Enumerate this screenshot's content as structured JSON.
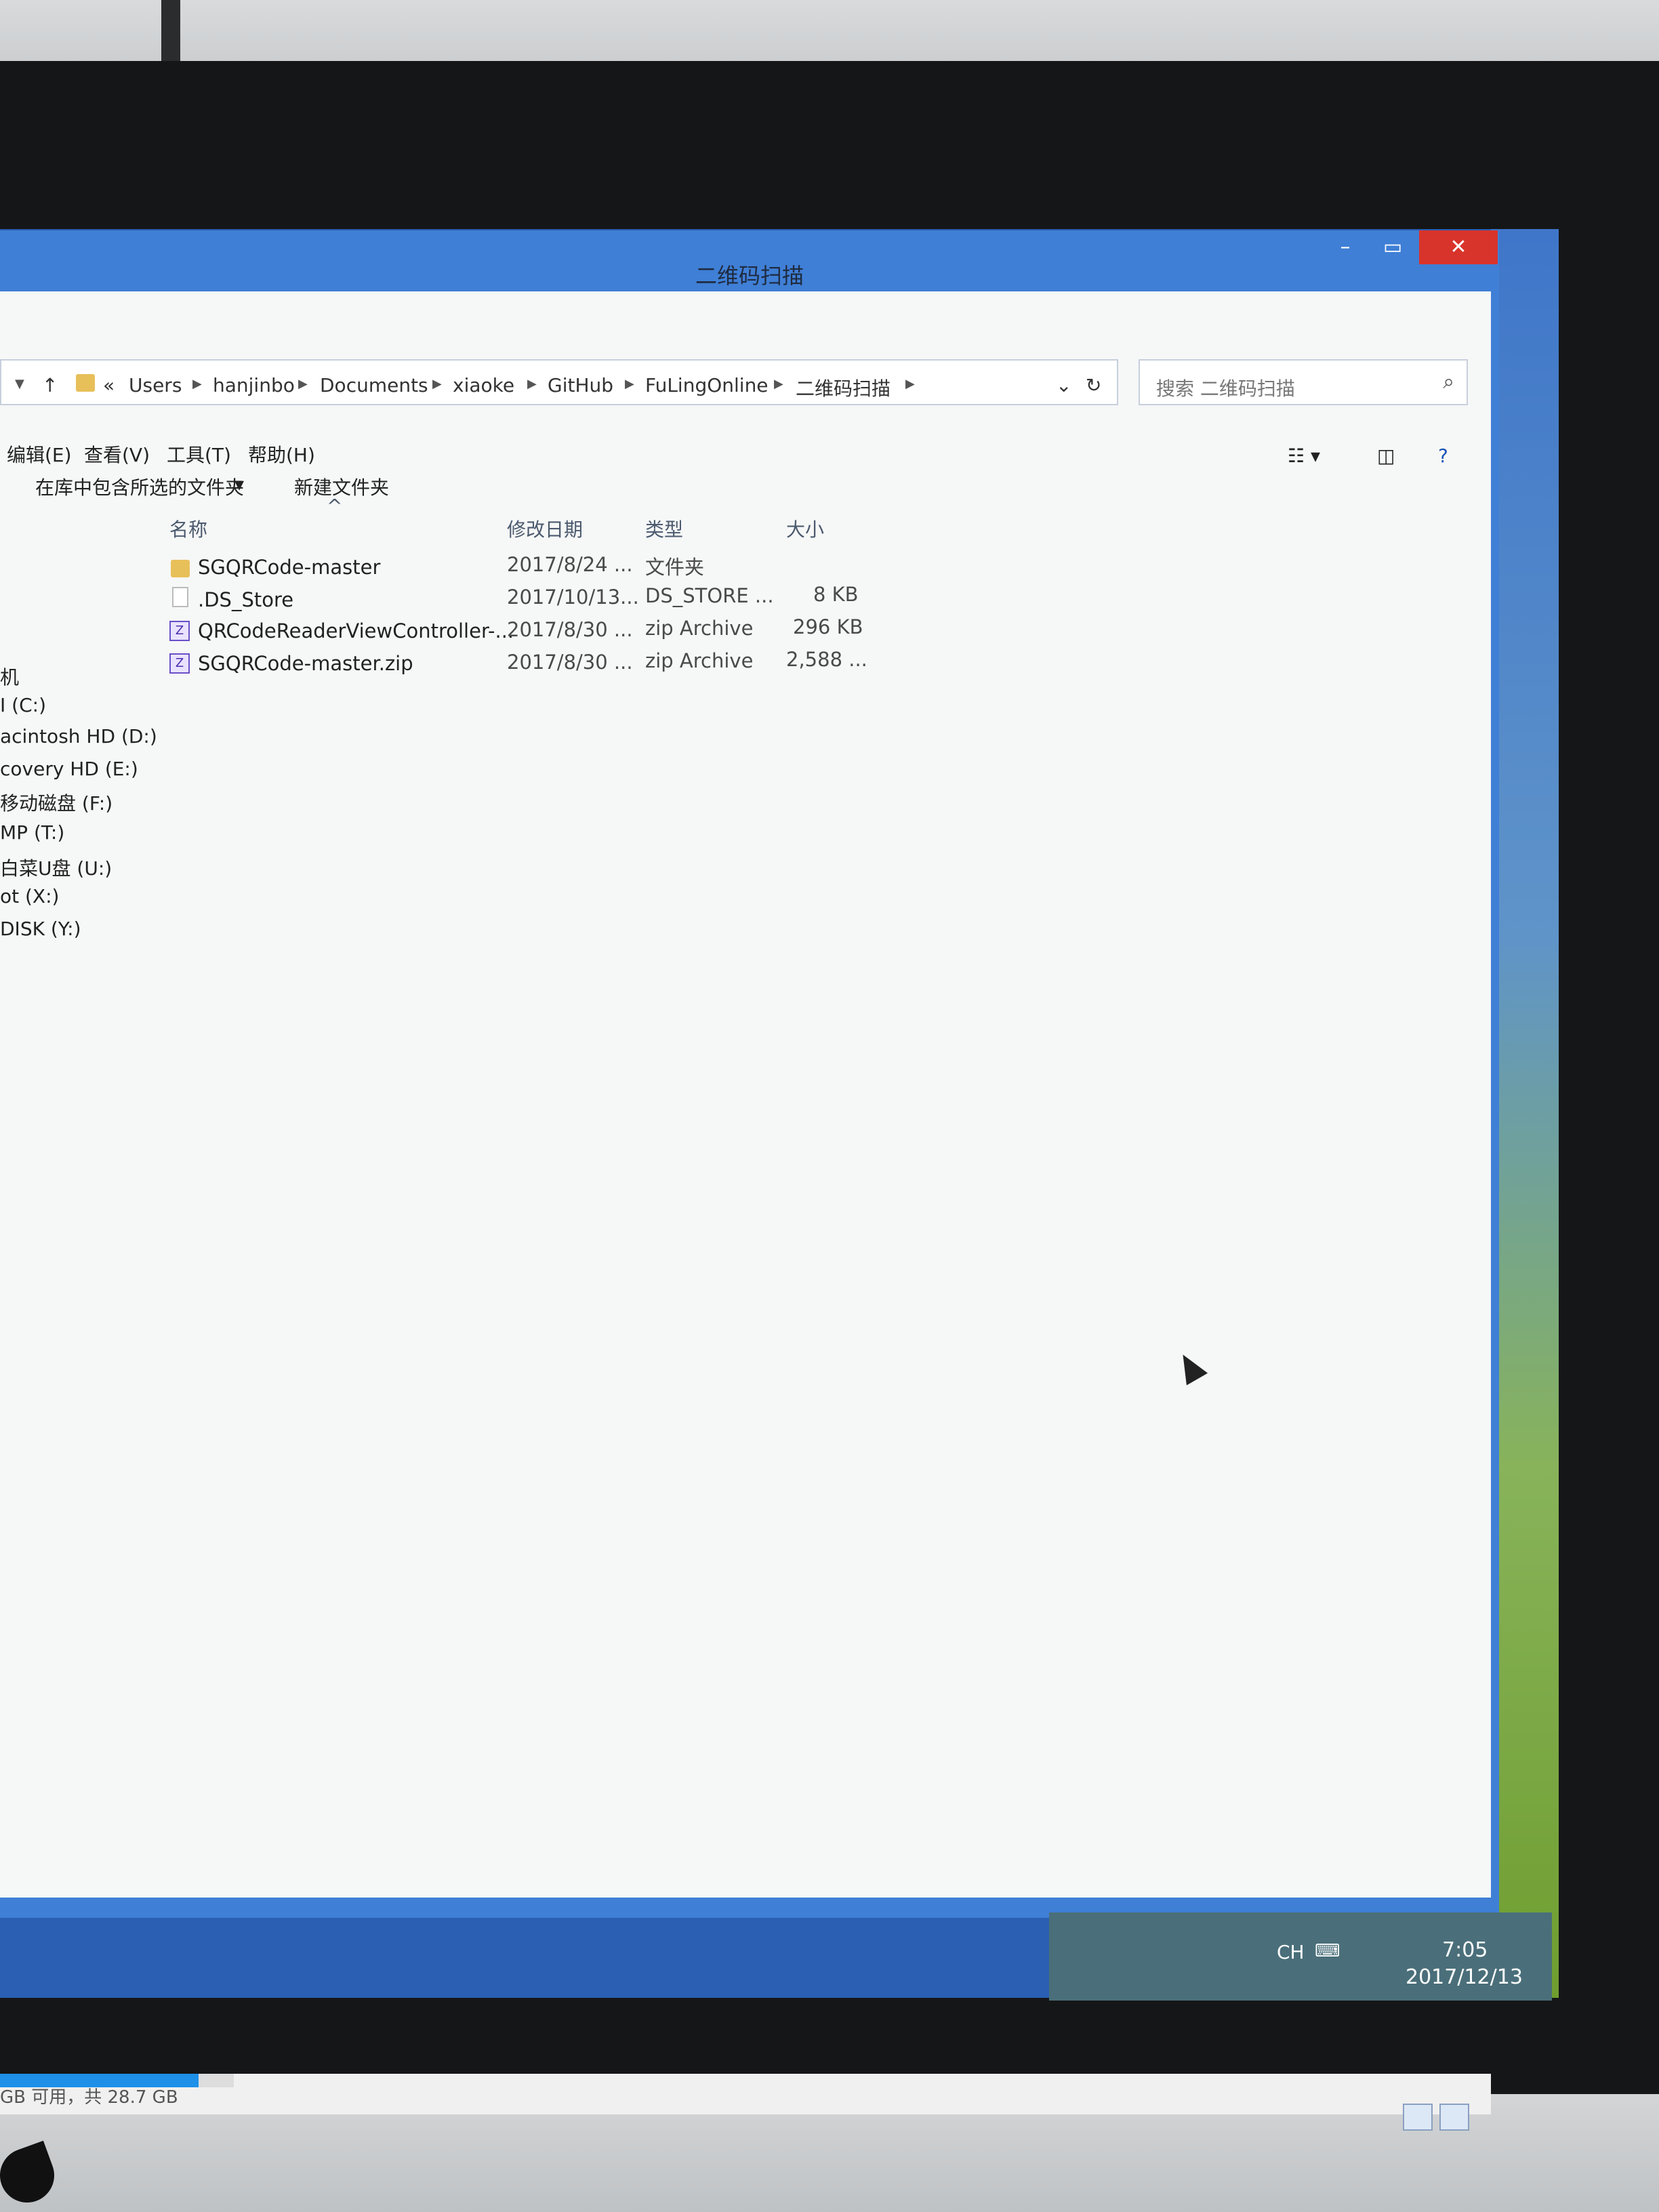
{
  "window": {
    "title": "二维码扫描",
    "controls": {
      "min": "–",
      "max": "▭",
      "close": "✕"
    }
  },
  "address": {
    "breadcrumbs": [
      "Users",
      "hanjinbo",
      "Documents",
      "xiaoke",
      "GitHub",
      "FuLingOnline",
      "二维码扫描"
    ]
  },
  "search": {
    "placeholder": "搜索 二维码扫描"
  },
  "menu": [
    "编辑(E)",
    "查看(V)",
    "工具(T)",
    "帮助(H)"
  ],
  "toolbar": {
    "include_library": "在库中包含所选的文件夹",
    "new_folder": "新建文件夹"
  },
  "columns": {
    "name": "名称",
    "date": "修改日期",
    "type": "类型",
    "size": "大小"
  },
  "files": [
    {
      "name": "SGQRCode-master",
      "date": "2017/8/24 ...",
      "type": "文件夹",
      "size": ""
    },
    {
      "name": ".DS_Store",
      "date": "2017/10/13...",
      "type": "DS_STORE ...",
      "size": "8 KB"
    },
    {
      "name": "QRCodeReaderViewController-...",
      "date": "2017/8/30 ...",
      "type": "zip Archive",
      "size": "296 KB"
    },
    {
      "name": "SGQRCode-master.zip",
      "date": "2017/8/30 ...",
      "type": "zip Archive",
      "size": "2,588 ..."
    }
  ],
  "nav": [
    "机",
    "I (C:)",
    "acintosh HD (D:)",
    "covery HD (E:)",
    "移动磁盘 (F:)",
    "MP (T:)",
    "白菜U盘 (U:)",
    "ot (X:)",
    "DISK (Y:)"
  ],
  "status": {
    "storage_text": "GB 可用，共 28.7 GB",
    "used_fraction": 0.85
  },
  "taskbar": {
    "lang": "CH",
    "time": "7:05",
    "date": "2017/12/13"
  }
}
